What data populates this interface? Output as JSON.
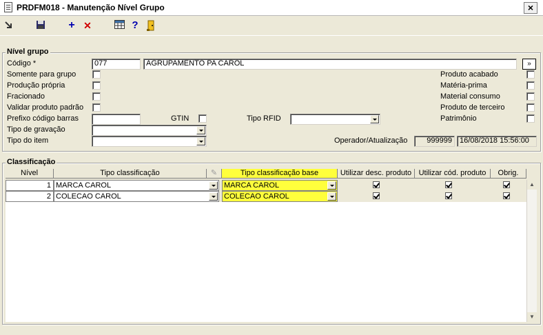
{
  "window": {
    "title": "PRDFM018 - Manutenção Nível Grupo",
    "close": "×"
  },
  "toolbar": {
    "add": "+",
    "delete": "✕",
    "help": "?"
  },
  "nivel_grupo": {
    "legend": "Nível grupo",
    "codigo_label": "Código *",
    "codigo_value": "077",
    "descricao_value": "AGRUPAMENTO PA  CAROL",
    "lookup_button": "»",
    "somente_grupo": "Somente para grupo",
    "producao_propria": "Produção própria",
    "fracionado": "Fracionado",
    "validar_produto": "Validar produto padrão",
    "prefixo_label": "Prefixo código barras",
    "gtin_label": "GTIN",
    "tipo_rfid_label": "Tipo RFID",
    "tipo_gravacao_label": "Tipo de gravação",
    "tipo_item_label": "Tipo do item",
    "produto_acabado": "Produto acabado",
    "materia_prima": "Matéria-prima",
    "material_consumo": "Material consumo",
    "produto_terceiro": "Produto de terceiro",
    "patrimonio": "Patrimônio",
    "operador_label": "Operador/Atualização",
    "operador_value": "999999",
    "atualizacao_value": "16/08/2018 15:56:00"
  },
  "classificacao": {
    "legend": "Classificação",
    "headers": {
      "nivel": "Nível",
      "tipo": "Tipo classificação",
      "tipo_base": "Tipo classificação base",
      "desc": "Utilizar desc. produto",
      "cod": "Utilizar cód. produto",
      "obrig": "Obrig."
    },
    "rows": [
      {
        "nivel": "1",
        "tipo": "MARCA CAROL",
        "tipo_base": "MARCA CAROL"
      },
      {
        "nivel": "2",
        "tipo": "COLECAO CAROL",
        "tipo_base": "COLECAO CAROL"
      }
    ]
  },
  "colors": {
    "highlight": "#ffff3c",
    "background": "#ece9d8",
    "save_icon": "#2a2a66",
    "add_icon": "#0000b0",
    "delete_icon": "#d00000"
  }
}
